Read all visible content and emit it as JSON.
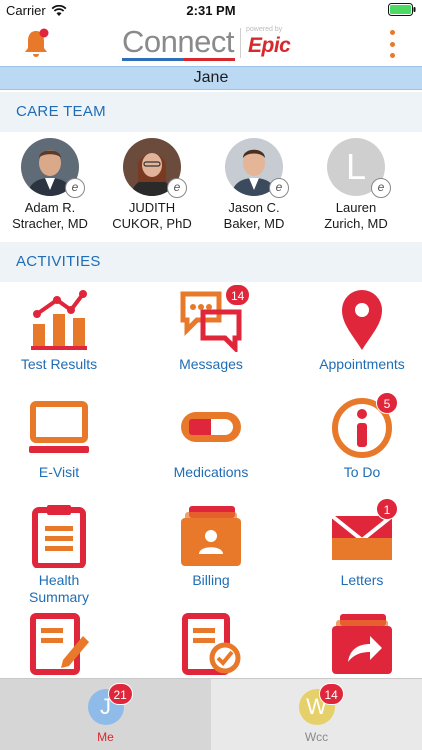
{
  "status_bar": {
    "carrier": "Carrier",
    "time": "2:31 PM"
  },
  "app_bar": {
    "logo_text": "Connect",
    "powered_by": "powered by",
    "logo_brand": "Epic",
    "notification_icon": "bell-icon",
    "menu_icon": "more-vertical-icon",
    "accent_color": "#e8792b"
  },
  "patient": {
    "name": "Jane"
  },
  "care_team": {
    "title": "CARE TEAM",
    "members": [
      {
        "line1": "Adam R.",
        "line2": "Stracher, MD"
      },
      {
        "line1": "JUDITH",
        "line2": "CUKOR, PhD"
      },
      {
        "line1": "Jason C.",
        "line2": "Baker, MD"
      },
      {
        "line1": "Lauren",
        "line2": "Zurich, MD",
        "initial": "L"
      }
    ]
  },
  "activities": {
    "title": "ACTIVITIES",
    "items": [
      {
        "label": "Test Results",
        "icon": "chart-icon"
      },
      {
        "label": "Messages",
        "icon": "chat-bubbles-icon",
        "badge": "14"
      },
      {
        "label": "Appointments",
        "icon": "location-pin-icon"
      },
      {
        "label": "E-Visit",
        "icon": "laptop-icon"
      },
      {
        "label": "Medications",
        "icon": "pill-icon"
      },
      {
        "label": "To Do",
        "icon": "info-icon",
        "badge": "5"
      },
      {
        "label": "Health Summary",
        "line1": "Health",
        "line2": "Summary",
        "icon": "clipboard-icon"
      },
      {
        "label": "Billing",
        "icon": "billing-folder-icon"
      },
      {
        "label": "Letters",
        "icon": "envelope-icon",
        "badge": "1"
      },
      {
        "label": "",
        "icon": "edit-document-icon"
      },
      {
        "label": "",
        "icon": "document-check-icon"
      },
      {
        "label": "",
        "icon": "share-folder-icon"
      }
    ]
  },
  "tabs": [
    {
      "label": "Me",
      "initial": "J",
      "badge": "21",
      "color": "#8fbbe8",
      "label_color": "#d9272e"
    },
    {
      "label": "Wcc",
      "initial": "W",
      "badge": "14",
      "color": "#e6d06a",
      "label_color": "#8a8a8a"
    }
  ]
}
